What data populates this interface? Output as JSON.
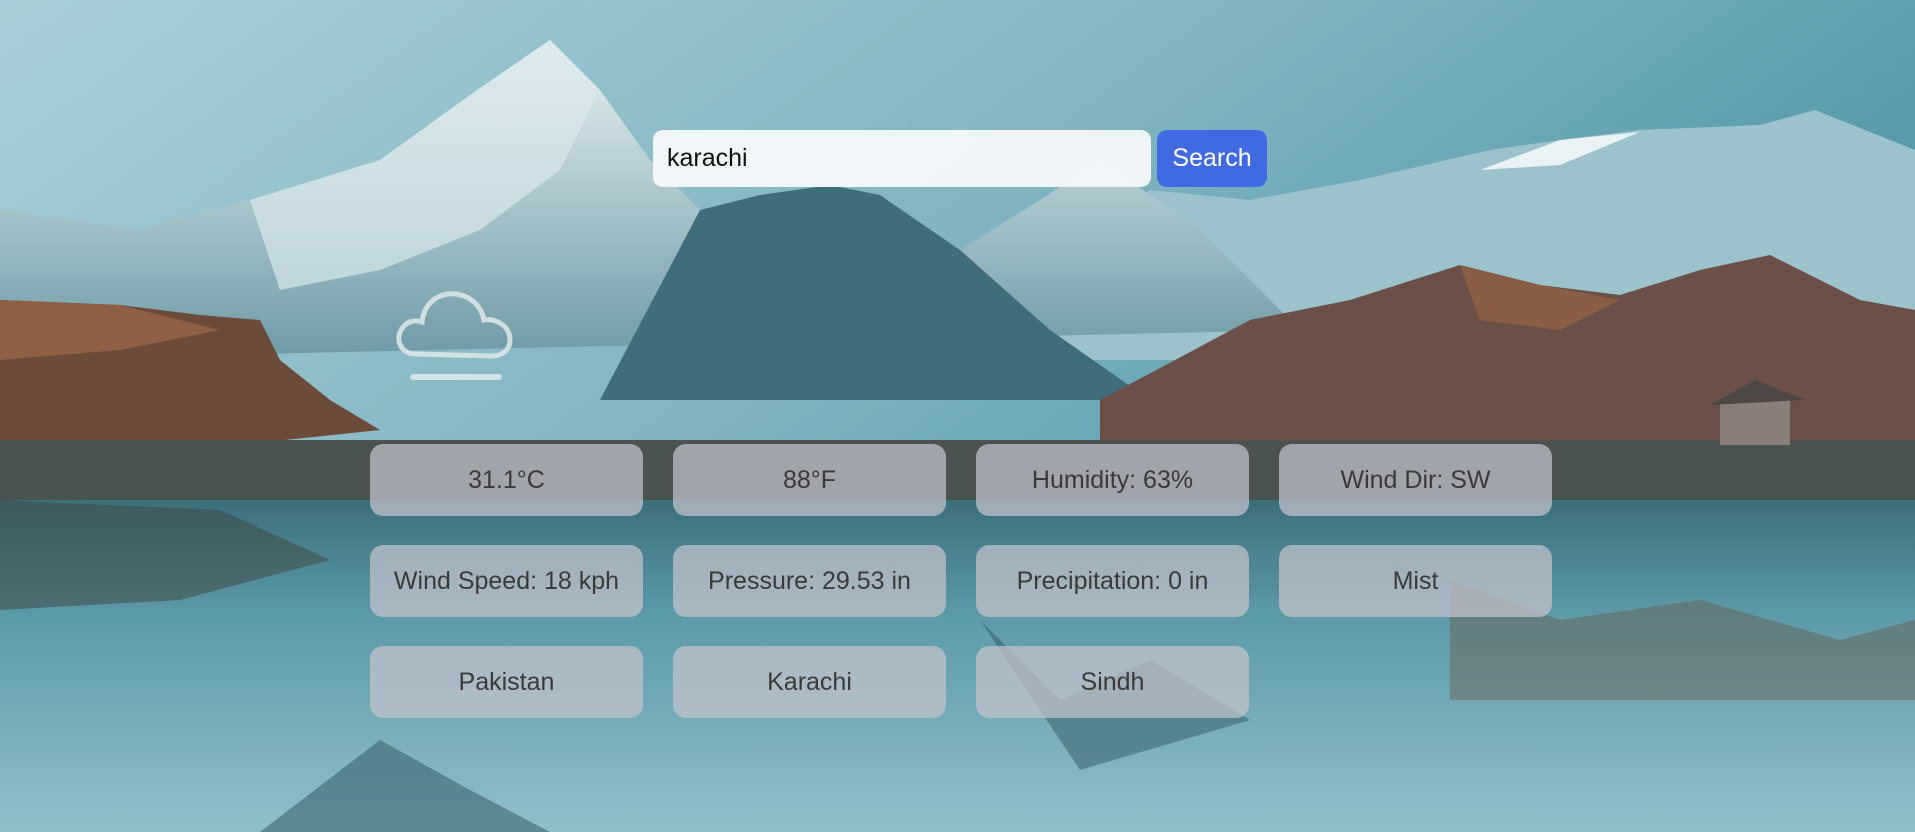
{
  "search": {
    "value": "karachi",
    "button_label": "Search"
  },
  "weather": {
    "icon": "mist-cloud-icon",
    "temp_c": "31.1°C",
    "temp_f": "88°F",
    "humidity": "Humidity: 63%",
    "wind_dir": "Wind Dir: SW",
    "wind_speed": "Wind Speed: 18 kph",
    "pressure": "Pressure: 29.53 in",
    "precipitation": "Precipitation: 0 in",
    "condition": "Mist",
    "country": "Pakistan",
    "city": "Karachi",
    "region": "Sindh"
  },
  "colors": {
    "accent": "#4169e1"
  }
}
